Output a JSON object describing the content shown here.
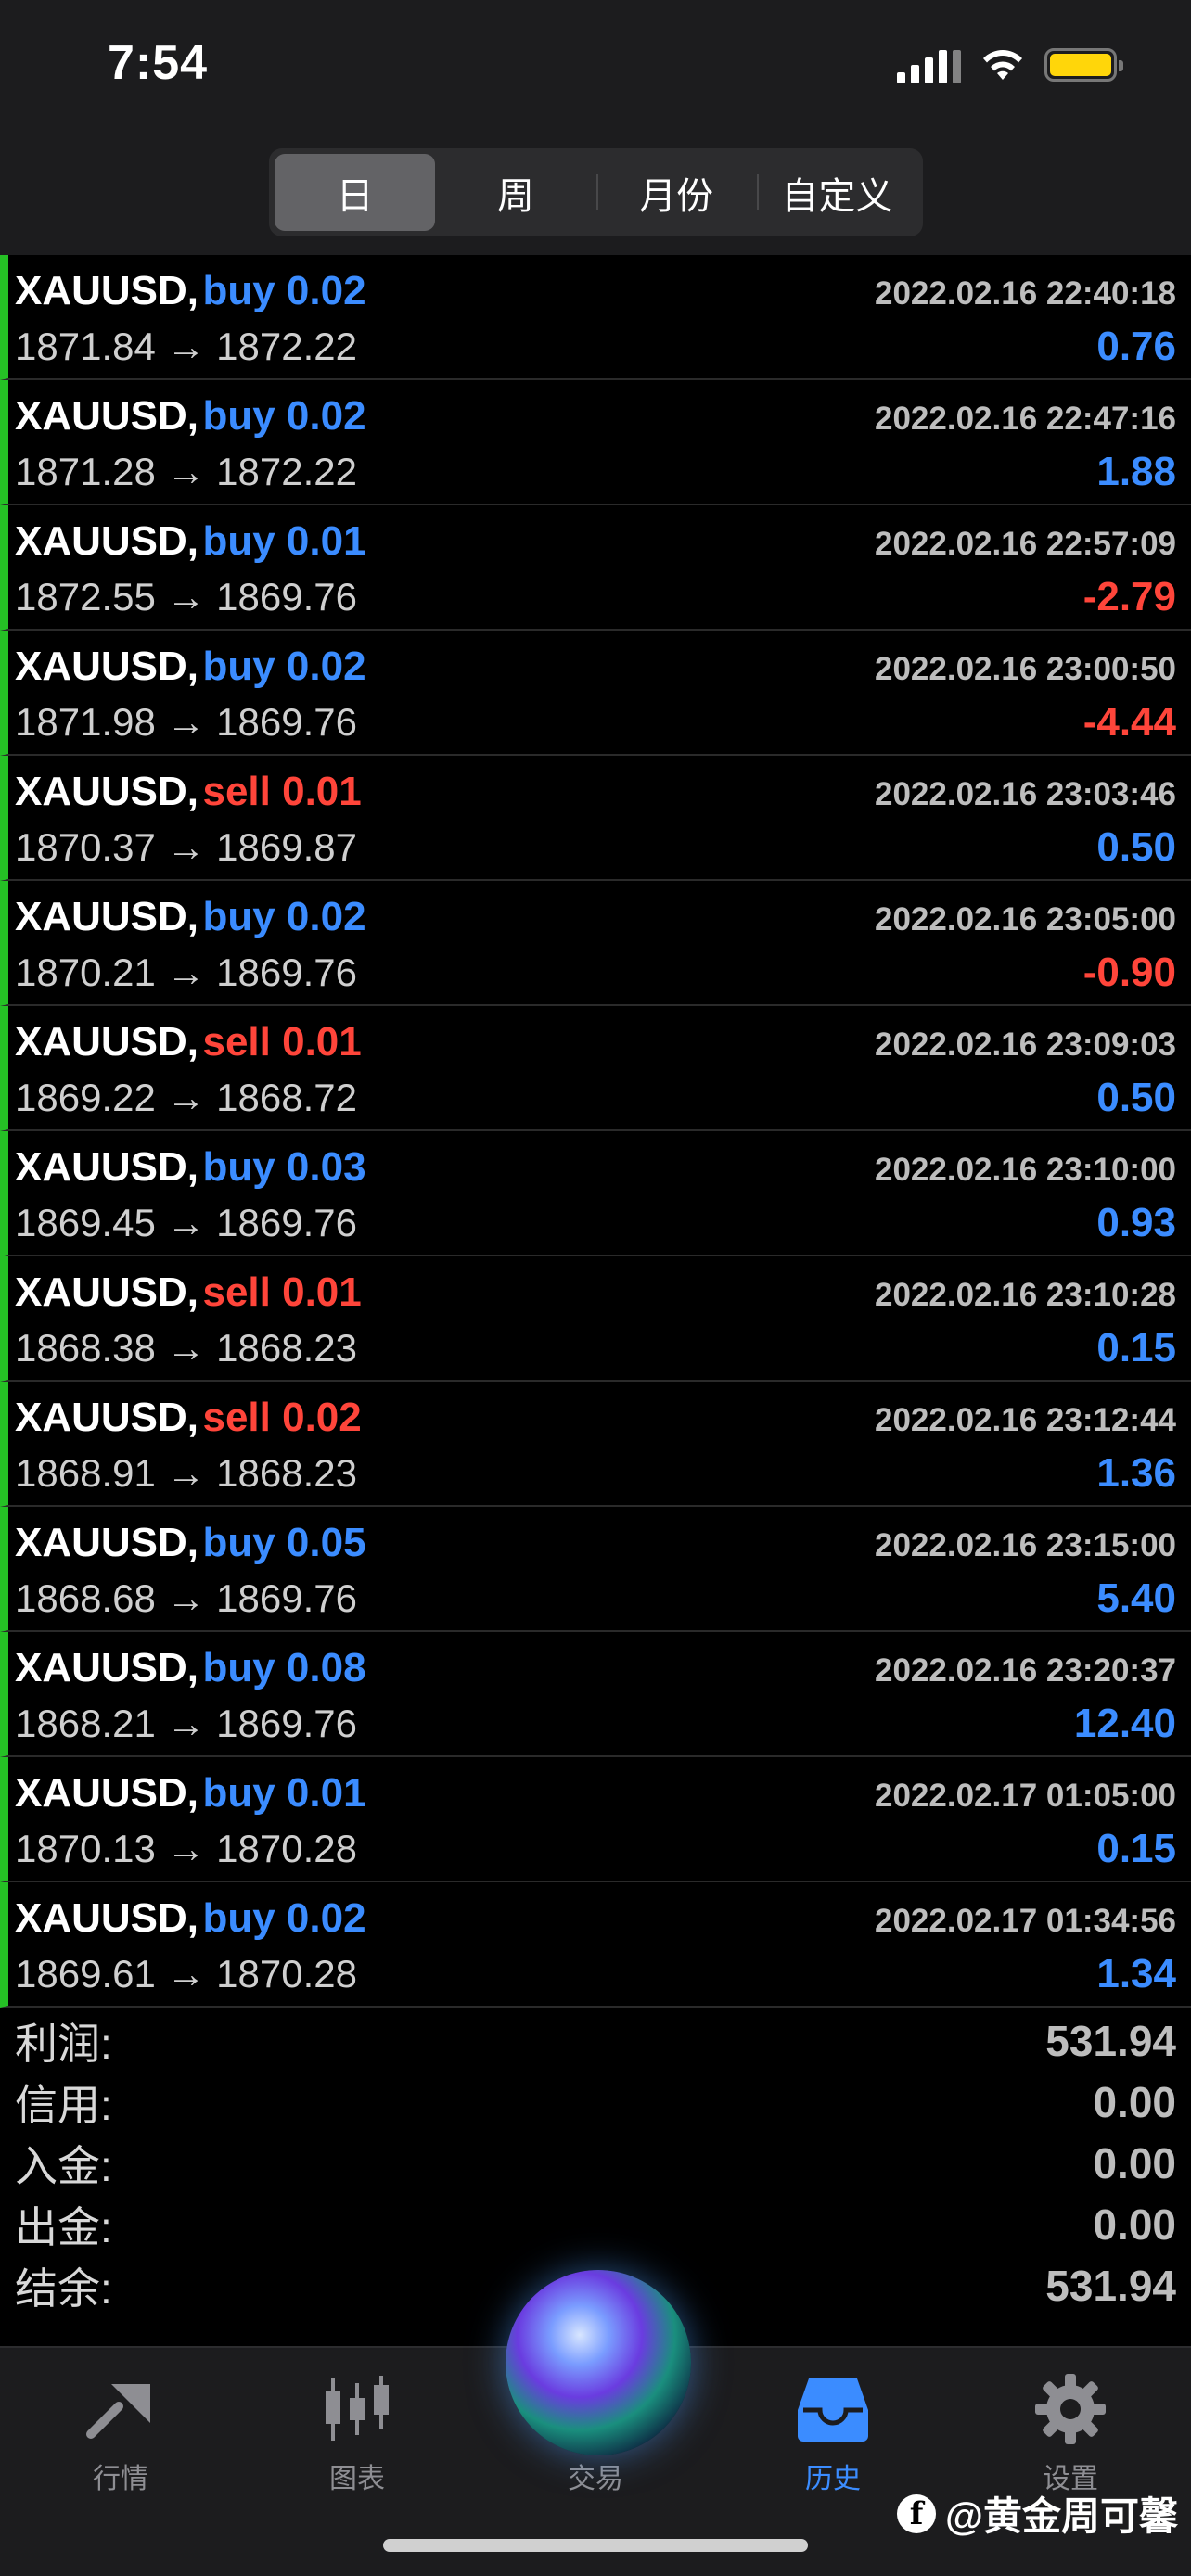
{
  "status_bar": {
    "time": "7:54"
  },
  "period_tabs": [
    {
      "label": "日",
      "active": true
    },
    {
      "label": "周",
      "active": false
    },
    {
      "label": "月份",
      "active": false
    },
    {
      "label": "自定义",
      "active": false
    }
  ],
  "trades": [
    {
      "symbol": "XAUUSD,",
      "side": "buy",
      "side_label": "buy 0.02",
      "time": "2022.02.16 22:40:18",
      "prices": "1871.84 → 1872.22",
      "profit": "0.76"
    },
    {
      "symbol": "XAUUSD,",
      "side": "buy",
      "side_label": "buy 0.02",
      "time": "2022.02.16 22:47:16",
      "prices": "1871.28 → 1872.22",
      "profit": "1.88"
    },
    {
      "symbol": "XAUUSD,",
      "side": "buy",
      "side_label": "buy 0.01",
      "time": "2022.02.16 22:57:09",
      "prices": "1872.55 → 1869.76",
      "profit": "-2.79"
    },
    {
      "symbol": "XAUUSD,",
      "side": "buy",
      "side_label": "buy 0.02",
      "time": "2022.02.16 23:00:50",
      "prices": "1871.98 → 1869.76",
      "profit": "-4.44"
    },
    {
      "symbol": "XAUUSD,",
      "side": "sell",
      "side_label": "sell 0.01",
      "time": "2022.02.16 23:03:46",
      "prices": "1870.37 → 1869.87",
      "profit": "0.50"
    },
    {
      "symbol": "XAUUSD,",
      "side": "buy",
      "side_label": "buy 0.02",
      "time": "2022.02.16 23:05:00",
      "prices": "1870.21 → 1869.76",
      "profit": "-0.90"
    },
    {
      "symbol": "XAUUSD,",
      "side": "sell",
      "side_label": "sell 0.01",
      "time": "2022.02.16 23:09:03",
      "prices": "1869.22 → 1868.72",
      "profit": "0.50"
    },
    {
      "symbol": "XAUUSD,",
      "side": "buy",
      "side_label": "buy 0.03",
      "time": "2022.02.16 23:10:00",
      "prices": "1869.45 → 1869.76",
      "profit": "0.93"
    },
    {
      "symbol": "XAUUSD,",
      "side": "sell",
      "side_label": "sell 0.01",
      "time": "2022.02.16 23:10:28",
      "prices": "1868.38 → 1868.23",
      "profit": "0.15"
    },
    {
      "symbol": "XAUUSD,",
      "side": "sell",
      "side_label": "sell 0.02",
      "time": "2022.02.16 23:12:44",
      "prices": "1868.91 → 1868.23",
      "profit": "1.36"
    },
    {
      "symbol": "XAUUSD,",
      "side": "buy",
      "side_label": "buy 0.05",
      "time": "2022.02.16 23:15:00",
      "prices": "1868.68 → 1869.76",
      "profit": "5.40"
    },
    {
      "symbol": "XAUUSD,",
      "side": "buy",
      "side_label": "buy 0.08",
      "time": "2022.02.16 23:20:37",
      "prices": "1868.21 → 1869.76",
      "profit": "12.40"
    },
    {
      "symbol": "XAUUSD,",
      "side": "buy",
      "side_label": "buy 0.01",
      "time": "2022.02.17 01:05:00",
      "prices": "1870.13 → 1870.28",
      "profit": "0.15"
    },
    {
      "symbol": "XAUUSD,",
      "side": "buy",
      "side_label": "buy 0.02",
      "time": "2022.02.17 01:34:56",
      "prices": "1869.61 → 1870.28",
      "profit": "1.34"
    }
  ],
  "summary": [
    {
      "label": "利润:",
      "value": "531.94"
    },
    {
      "label": "信用:",
      "value": "0.00"
    },
    {
      "label": "入金:",
      "value": "0.00"
    },
    {
      "label": "出金:",
      "value": "0.00"
    },
    {
      "label": "结余:",
      "value": "531.94"
    }
  ],
  "tabbar": [
    {
      "label": "行情",
      "icon": "quotes-icon",
      "active": false
    },
    {
      "label": "图表",
      "icon": "chart-candles-icon",
      "active": false
    },
    {
      "label": "交易",
      "icon": "trade-icon",
      "active": false
    },
    {
      "label": "历史",
      "icon": "history-inbox-icon",
      "active": true
    },
    {
      "label": "设置",
      "icon": "gear-icon",
      "active": false
    }
  ],
  "watermark": {
    "logo": "f",
    "text": "@黄金周可馨"
  },
  "colors": {
    "buy": "#3b8cff",
    "sell": "#ff453a",
    "row_marker": "#25c025",
    "active_tab": "#3b8cff"
  }
}
